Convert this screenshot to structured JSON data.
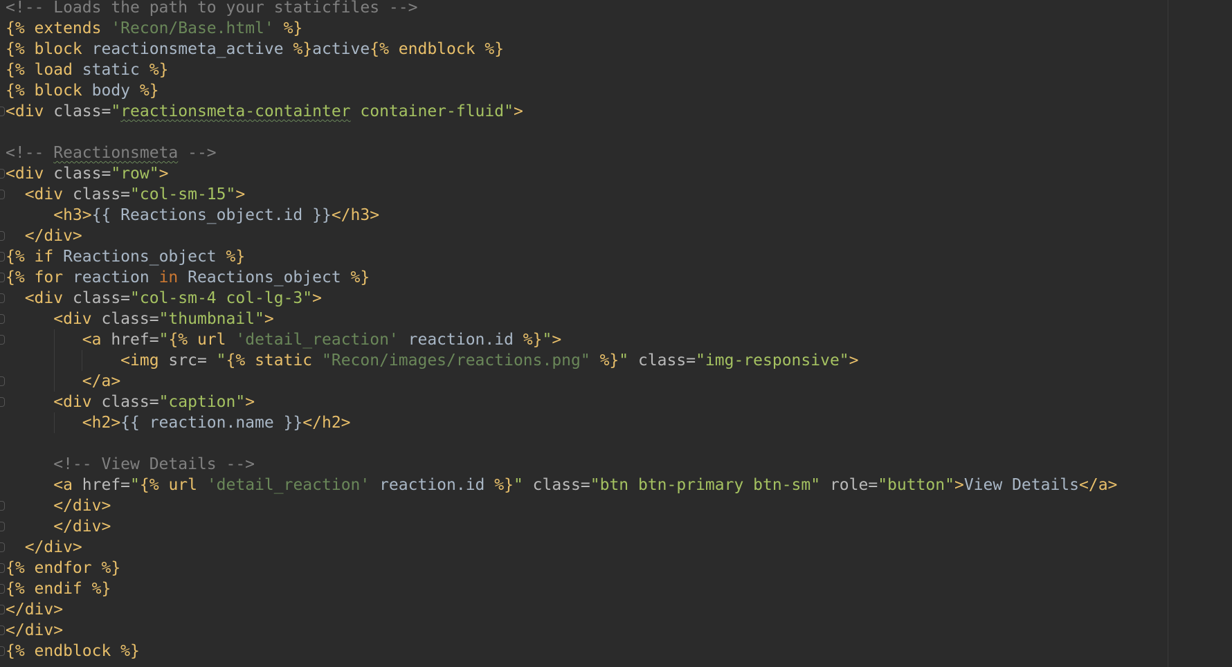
{
  "editor": {
    "language": "django-html",
    "colors": {
      "background": "#2b2b2b",
      "comment": "#808080",
      "template_delimiter": "#e8bf6a",
      "html_tag": "#e8bf6a",
      "attribute": "#bababa",
      "attribute_string": "#a5c261",
      "template_string": "#6a8759",
      "keyword": "#cc7832",
      "plain_text": "#a9b7c6"
    },
    "code_lines": [
      [
        {
          "t": "<!-- Loads the path to your staticfiles -->",
          "c": "comment"
        }
      ],
      [
        {
          "t": "{% ",
          "c": "tmpl"
        },
        {
          "t": "extends ",
          "c": "tmpl-kw"
        },
        {
          "t": "'Recon/Base.html'",
          "c": "tstr"
        },
        {
          "t": " %}",
          "c": "tmpl"
        }
      ],
      [
        {
          "t": "{% ",
          "c": "tmpl"
        },
        {
          "t": "block ",
          "c": "tmpl-kw"
        },
        {
          "t": "reactionsmeta_active ",
          "c": "plain"
        },
        {
          "t": "%}",
          "c": "tmpl"
        },
        {
          "t": "active",
          "c": "plain"
        },
        {
          "t": "{% ",
          "c": "tmpl"
        },
        {
          "t": "endblock",
          "c": "tmpl-kw"
        },
        {
          "t": " %}",
          "c": "tmpl"
        }
      ],
      [
        {
          "t": "{% ",
          "c": "tmpl"
        },
        {
          "t": "load ",
          "c": "tmpl-kw"
        },
        {
          "t": "static ",
          "c": "plain"
        },
        {
          "t": "%}",
          "c": "tmpl"
        }
      ],
      [
        {
          "t": "{% ",
          "c": "tmpl"
        },
        {
          "t": "block ",
          "c": "tmpl-kw"
        },
        {
          "t": "body ",
          "c": "plain"
        },
        {
          "t": "%}",
          "c": "tmpl"
        }
      ],
      [
        {
          "t": "<div ",
          "c": "tag"
        },
        {
          "t": "class=",
          "c": "attr"
        },
        {
          "t": "\"",
          "c": "str"
        },
        {
          "t": "reactionsmeta-containter",
          "c": "str-squiggle"
        },
        {
          "t": " container-fluid\"",
          "c": "str"
        },
        {
          "t": ">",
          "c": "tag"
        }
      ],
      [],
      [
        {
          "t": "<!-- ",
          "c": "comment"
        },
        {
          "t": "Reactionsmeta",
          "c": "comment-squiggle"
        },
        {
          "t": " -->",
          "c": "comment"
        }
      ],
      [
        {
          "t": "<div ",
          "c": "tag"
        },
        {
          "t": "class=",
          "c": "attr"
        },
        {
          "t": "\"row\"",
          "c": "str"
        },
        {
          "t": ">",
          "c": "tag"
        }
      ],
      [
        {
          "t": "  <div ",
          "c": "tag"
        },
        {
          "t": "class=",
          "c": "attr"
        },
        {
          "t": "\"col-sm-15\"",
          "c": "str"
        },
        {
          "t": ">",
          "c": "tag"
        }
      ],
      [
        {
          "t": "     <h3>",
          "c": "tag"
        },
        {
          "t": "{{ Reactions_object.id }}",
          "c": "plain"
        },
        {
          "t": "</h3>",
          "c": "tag"
        }
      ],
      [
        {
          "t": "  </div>",
          "c": "tag"
        }
      ],
      [
        {
          "t": "{% ",
          "c": "tmpl"
        },
        {
          "t": "if ",
          "c": "tmpl-kw"
        },
        {
          "t": "Reactions_object ",
          "c": "plain"
        },
        {
          "t": "%}",
          "c": "tmpl"
        }
      ],
      [
        {
          "t": "{% ",
          "c": "tmpl"
        },
        {
          "t": "for ",
          "c": "tmpl-kw"
        },
        {
          "t": "reaction ",
          "c": "plain"
        },
        {
          "t": "in ",
          "c": "kw"
        },
        {
          "t": "Reactions_object ",
          "c": "plain"
        },
        {
          "t": "%}",
          "c": "tmpl"
        }
      ],
      [
        {
          "t": "  <div ",
          "c": "tag"
        },
        {
          "t": "class=",
          "c": "attr"
        },
        {
          "t": "\"col-sm-4 col-lg-3\"",
          "c": "str"
        },
        {
          "t": ">",
          "c": "tag"
        }
      ],
      [
        {
          "t": "     <div ",
          "c": "tag"
        },
        {
          "t": "class=",
          "c": "attr"
        },
        {
          "t": "\"thumbnail\"",
          "c": "str"
        },
        {
          "t": ">",
          "c": "tag"
        }
      ],
      [
        {
          "t": "        <a ",
          "c": "tag"
        },
        {
          "t": "href=",
          "c": "attr"
        },
        {
          "t": "\"",
          "c": "str"
        },
        {
          "t": "{% ",
          "c": "tmpl"
        },
        {
          "t": "url ",
          "c": "tmpl-kw"
        },
        {
          "t": "'detail_reaction'",
          "c": "tstr"
        },
        {
          "t": " reaction.id ",
          "c": "plain"
        },
        {
          "t": "%}",
          "c": "tmpl"
        },
        {
          "t": "\"",
          "c": "str"
        },
        {
          "t": ">",
          "c": "tag"
        }
      ],
      [
        {
          "t": "            <img ",
          "c": "tag"
        },
        {
          "t": "src= ",
          "c": "attr"
        },
        {
          "t": "\"",
          "c": "str"
        },
        {
          "t": "{% ",
          "c": "tmpl"
        },
        {
          "t": "static ",
          "c": "tmpl-kw"
        },
        {
          "t": "\"Recon/images/reactions.png\"",
          "c": "tstr"
        },
        {
          "t": " %}",
          "c": "tmpl"
        },
        {
          "t": "\"",
          "c": "str"
        },
        {
          "t": " class=",
          "c": "attr"
        },
        {
          "t": "\"img-responsive\"",
          "c": "str"
        },
        {
          "t": ">",
          "c": "tag"
        }
      ],
      [
        {
          "t": "        </a>",
          "c": "tag"
        }
      ],
      [
        {
          "t": "     <div ",
          "c": "tag"
        },
        {
          "t": "class=",
          "c": "attr"
        },
        {
          "t": "\"caption\"",
          "c": "str"
        },
        {
          "t": ">",
          "c": "tag"
        }
      ],
      [
        {
          "t": "        <h2>",
          "c": "tag"
        },
        {
          "t": "{{ reaction.name }}",
          "c": "plain"
        },
        {
          "t": "</h2>",
          "c": "tag"
        }
      ],
      [],
      [
        {
          "t": "     <!-- View Details -->",
          "c": "comment"
        }
      ],
      [
        {
          "t": "     <a ",
          "c": "tag"
        },
        {
          "t": "href=",
          "c": "attr"
        },
        {
          "t": "\"",
          "c": "str"
        },
        {
          "t": "{% ",
          "c": "tmpl"
        },
        {
          "t": "url ",
          "c": "tmpl-kw"
        },
        {
          "t": "'detail_reaction'",
          "c": "tstr"
        },
        {
          "t": " reaction.id ",
          "c": "plain"
        },
        {
          "t": "%}",
          "c": "tmpl"
        },
        {
          "t": "\"",
          "c": "str"
        },
        {
          "t": " class=",
          "c": "attr"
        },
        {
          "t": "\"btn btn-primary btn-sm\"",
          "c": "str"
        },
        {
          "t": " role=",
          "c": "attr"
        },
        {
          "t": "\"button\"",
          "c": "str"
        },
        {
          "t": ">",
          "c": "tag"
        },
        {
          "t": "View Details",
          "c": "plain"
        },
        {
          "t": "</a>",
          "c": "tag"
        }
      ],
      [
        {
          "t": "     </div>",
          "c": "tag"
        }
      ],
      [
        {
          "t": "     </div>",
          "c": "tag"
        }
      ],
      [
        {
          "t": "  </div>",
          "c": "tag"
        }
      ],
      [
        {
          "t": "{% ",
          "c": "tmpl"
        },
        {
          "t": "endfor ",
          "c": "tmpl-kw"
        },
        {
          "t": "%}",
          "c": "tmpl"
        }
      ],
      [
        {
          "t": "{% ",
          "c": "tmpl"
        },
        {
          "t": "endif ",
          "c": "tmpl-kw"
        },
        {
          "t": "%}",
          "c": "tmpl"
        }
      ],
      [
        {
          "t": "</div>",
          "c": "tag"
        }
      ],
      [
        {
          "t": "</div>",
          "c": "tag"
        }
      ],
      [
        {
          "t": "{% ",
          "c": "tmpl"
        },
        {
          "t": "endblock ",
          "c": "tmpl-kw"
        },
        {
          "t": "%}",
          "c": "tmpl"
        }
      ]
    ]
  }
}
